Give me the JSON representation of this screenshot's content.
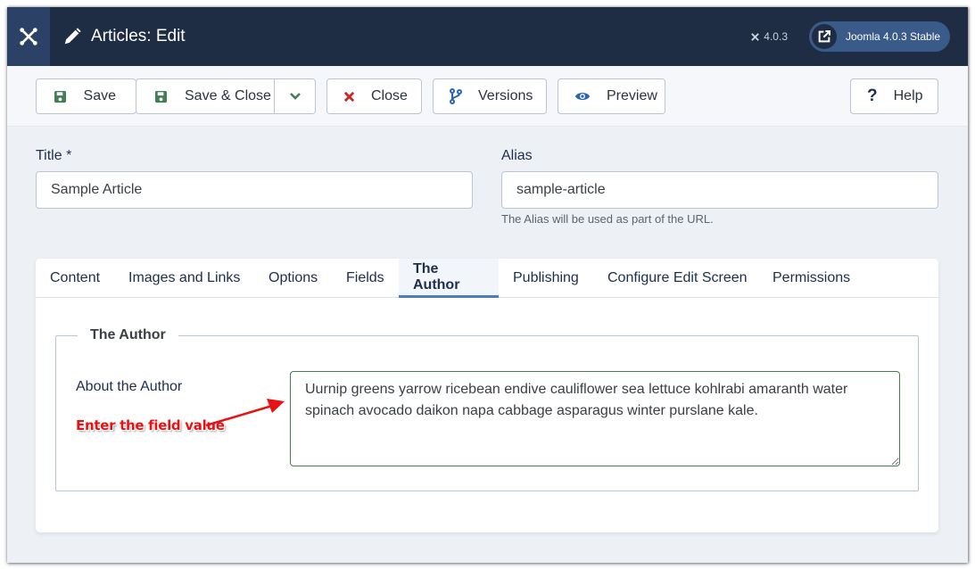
{
  "header": {
    "title": "Articles: Edit",
    "version": "4.0.3",
    "site_link": "Joomla 4.0.3 Stable"
  },
  "toolbar": {
    "save_label": "Save",
    "save_close_label": "Save & Close",
    "close_label": "Close",
    "versions_label": "Versions",
    "preview_label": "Preview",
    "help_label": "Help"
  },
  "form": {
    "title_label": "Title *",
    "title_value": "Sample Article",
    "alias_label": "Alias",
    "alias_value": "sample-article",
    "alias_help": "The Alias will be used as part of the URL."
  },
  "tabs": [
    {
      "label": "Content"
    },
    {
      "label": "Images and Links"
    },
    {
      "label": "Options"
    },
    {
      "label": "Fields"
    },
    {
      "label": "The Author",
      "active": true
    },
    {
      "label": "Publishing"
    },
    {
      "label": "Configure Edit Screen"
    },
    {
      "label": "Permissions"
    }
  ],
  "author_panel": {
    "legend": "The Author",
    "field_label": "About the Author",
    "field_value": "Uurnip greens yarrow ricebean endive cauliflower sea lettuce kohlrabi amaranth water spinach avocado daikon napa cabbage asparagus winter purslane kale.",
    "annotation": "Enter the field value"
  },
  "colors": {
    "header_bg": "#1f2d44",
    "accent": "#4b7dc0",
    "save_icon": "#457d54",
    "close_icon": "#c52827",
    "annotation": "#e81212"
  }
}
